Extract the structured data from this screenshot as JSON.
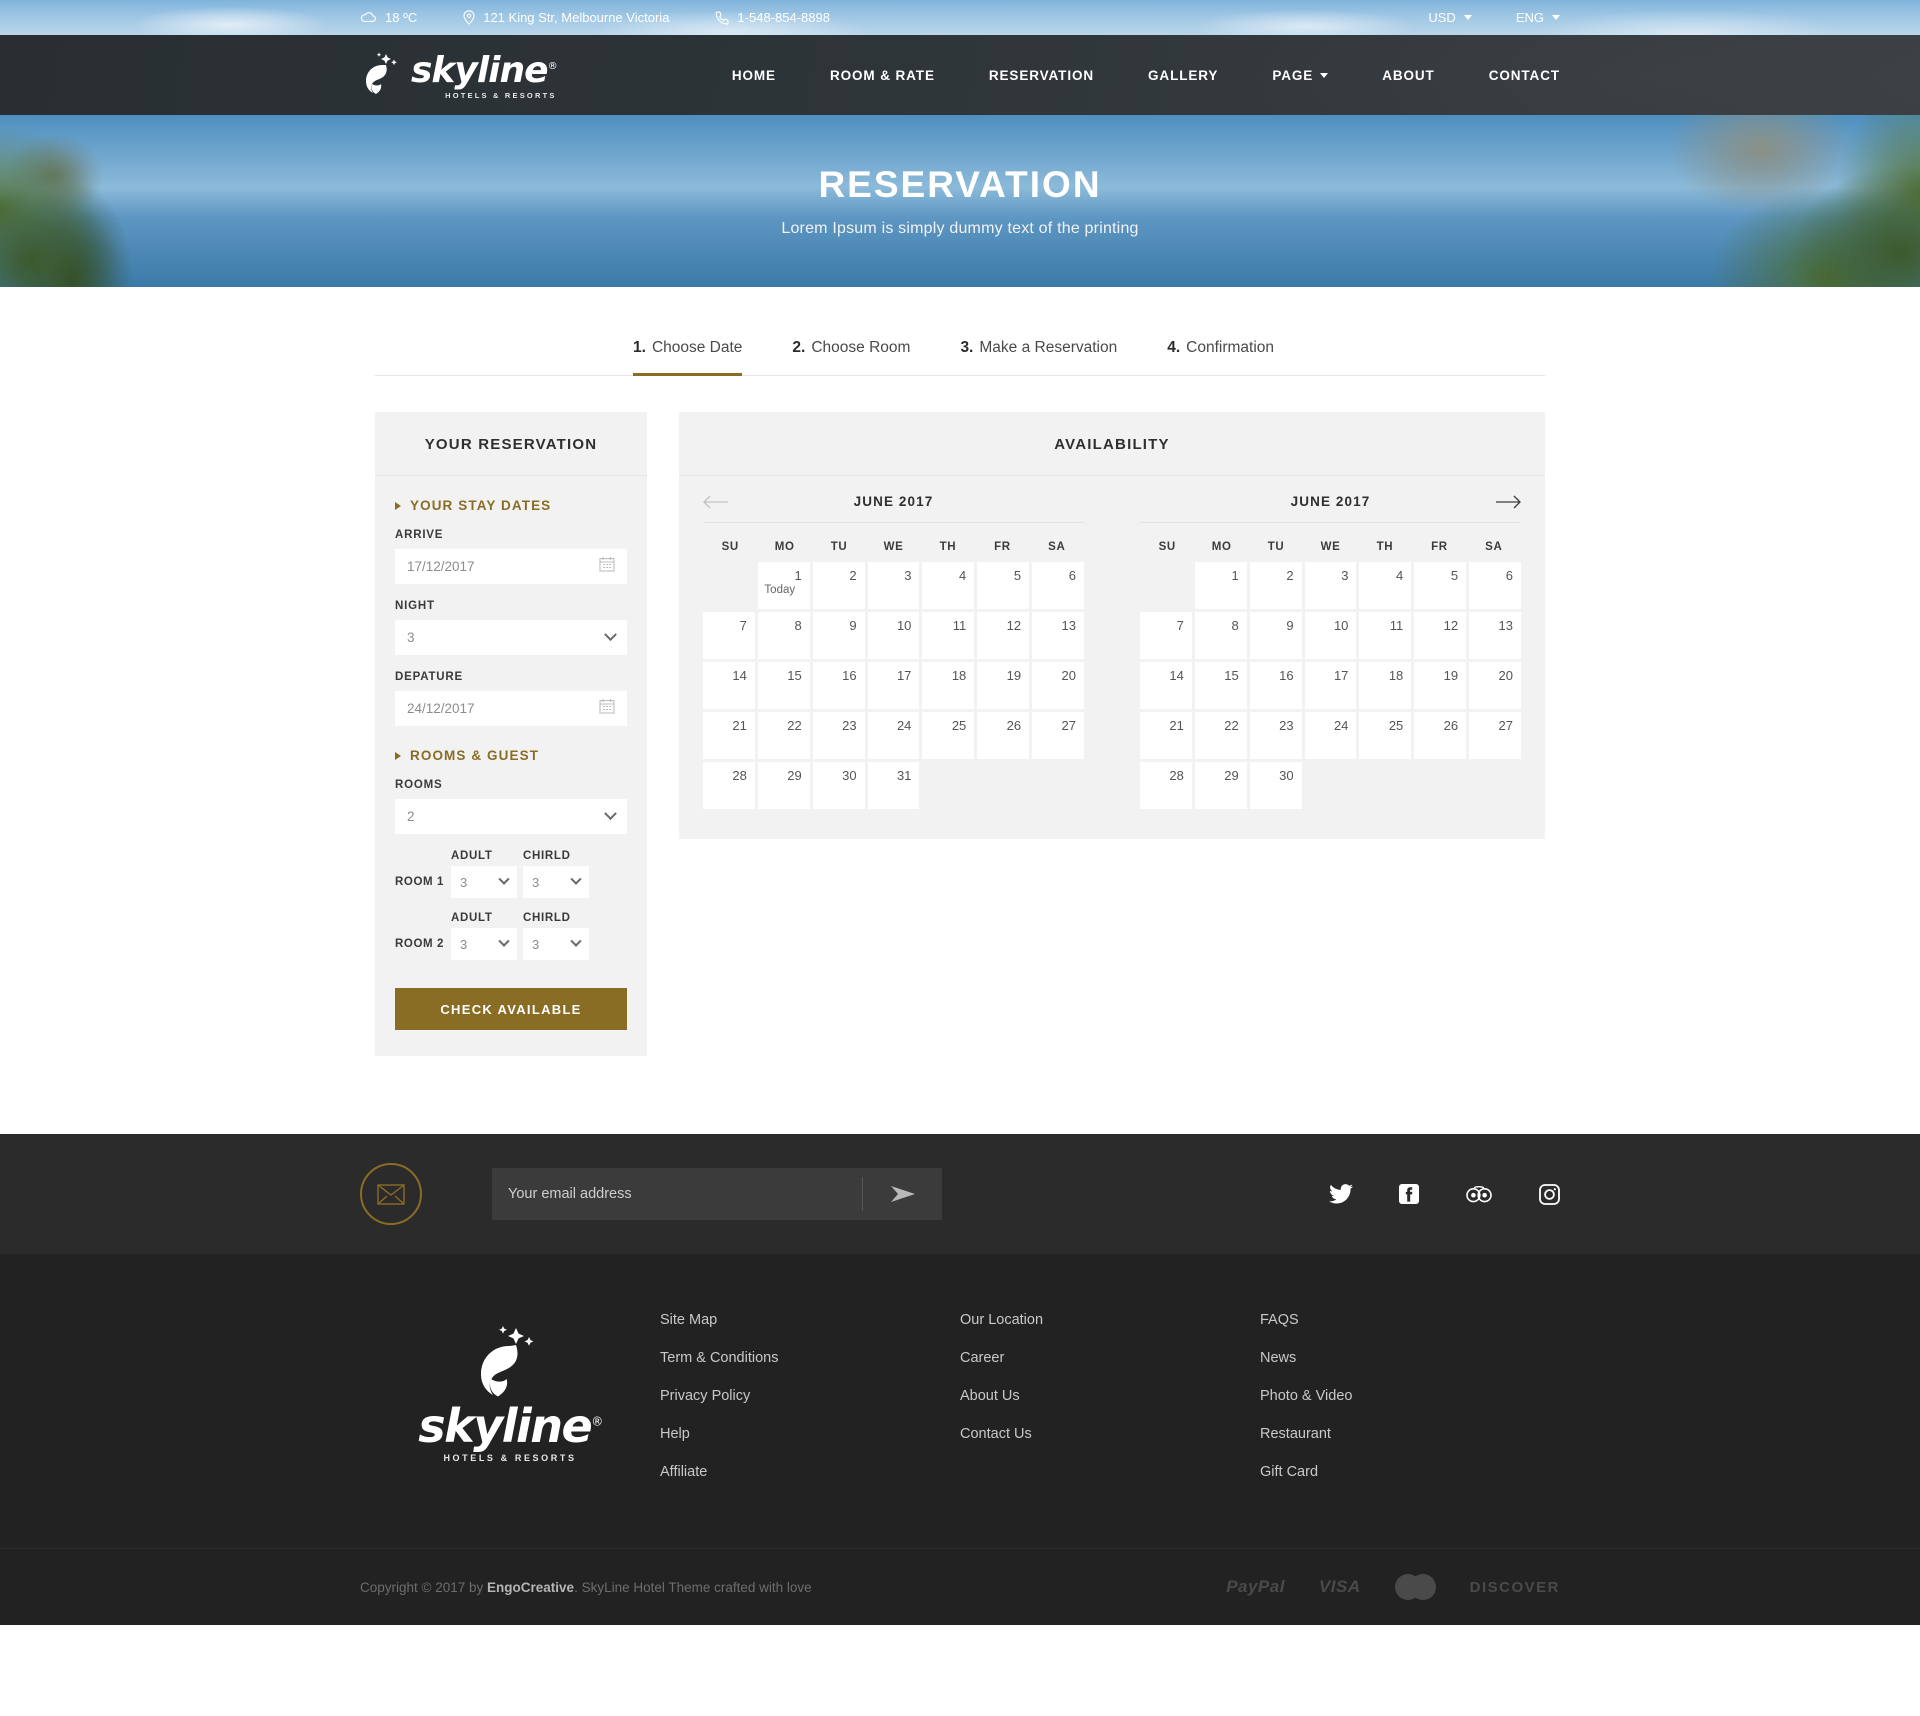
{
  "topbar": {
    "weather": "18 ºC",
    "address": "121 King Str, Melbourne Victoria",
    "phone": "1-548-854-8898",
    "currency": "USD",
    "language": "ENG"
  },
  "brand": {
    "name": "skyline",
    "registered": "®",
    "tagline": "HOTELS & RESORTS"
  },
  "nav": {
    "items": [
      {
        "label": "HOME",
        "has_caret": false
      },
      {
        "label": "ROOM & RATE",
        "has_caret": false
      },
      {
        "label": "RESERVATION",
        "has_caret": false
      },
      {
        "label": "GALLERY",
        "has_caret": false
      },
      {
        "label": "PAGE",
        "has_caret": true
      },
      {
        "label": "ABOUT",
        "has_caret": false
      },
      {
        "label": "CONTACT",
        "has_caret": false
      }
    ]
  },
  "hero": {
    "title": "RESERVATION",
    "subtitle": "Lorem Ipsum is simply dummy text of the printing"
  },
  "steps": [
    {
      "num": "1.",
      "label": "Choose Date",
      "active": true
    },
    {
      "num": "2.",
      "label": "Choose Room",
      "active": false
    },
    {
      "num": "3.",
      "label": "Make a Reservation",
      "active": false
    },
    {
      "num": "4.",
      "label": "Confirmation",
      "active": false
    }
  ],
  "reservation": {
    "panel_title": "YOUR RESERVATION",
    "stay_dates_title": "YOUR STAY DATES",
    "arrive_label": "ARRIVE",
    "arrive_value": "17/12/2017",
    "night_label": "NIGHT",
    "night_value": "3",
    "departure_label": "DEPATURE",
    "departure_value": "24/12/2017",
    "rooms_guest_title": "ROOMS & GUEST",
    "rooms_label": "ROOMS",
    "rooms_value": "2",
    "adult_label": "ADULT",
    "child_label": "CHIRLD",
    "room_rows": [
      {
        "label": "ROOM 1",
        "adult": "3",
        "child": "3"
      },
      {
        "label": "ROOM 2",
        "adult": "3",
        "child": "3"
      }
    ],
    "check_button": "CHECK AVAILABLE"
  },
  "availability": {
    "panel_title": "AVAILABILITY",
    "dow": [
      "SU",
      "MO",
      "TU",
      "WE",
      "TH",
      "FR",
      "SA"
    ],
    "calendars": [
      {
        "title": "JUNE 2017",
        "lead_blanks": 1,
        "days": 31,
        "today": 1,
        "today_label": "Today"
      },
      {
        "title": "JUNE 2017",
        "lead_blanks": 1,
        "days": 30,
        "today": 0,
        "today_label": ""
      }
    ]
  },
  "newsletter": {
    "placeholder": "Your email address",
    "socials": [
      "twitter-icon",
      "facebook-icon",
      "tripadvisor-icon",
      "instagram-icon"
    ]
  },
  "footer": {
    "columns": [
      [
        "Site Map",
        "Term & Conditions",
        "Privacy Policy",
        "Help",
        "Affiliate"
      ],
      [
        "Our Location",
        "Career",
        "About Us",
        "Contact Us"
      ],
      [
        "FAQS",
        "News",
        "Photo & Video",
        "Restaurant",
        "Gift Card"
      ]
    ],
    "copyright_pre": "Copyright © 2017 by ",
    "copyright_brand": "EngoCreative",
    "copyright_post": ". SkyLine Hotel Theme crafted with love",
    "payments": [
      "PayPal",
      "VISA",
      "MasterCard",
      "DISCOVER"
    ]
  },
  "colors": {
    "accent": "#8a6d24",
    "header_bg": "#2d3134",
    "footer_bg": "#222222",
    "panel_bg": "#f2f2f2"
  }
}
